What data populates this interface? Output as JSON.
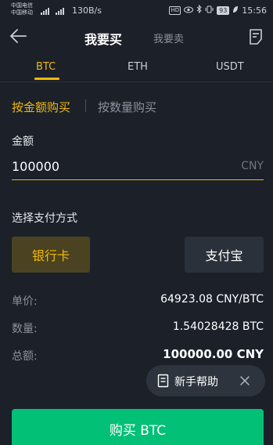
{
  "status_bar": {
    "carrier_1": "中国电信",
    "carrier_2": "中国移动",
    "speed": "130B/s",
    "hd_badge": "HD",
    "battery": "93",
    "time": "15:56"
  },
  "header": {
    "title_active": "我要买",
    "title_inactive": "我要卖"
  },
  "coin_tabs": [
    {
      "label": "BTC",
      "active": true
    },
    {
      "label": "ETH",
      "active": false
    },
    {
      "label": "USDT",
      "active": false
    }
  ],
  "mode": {
    "by_amount": "按金额购买",
    "by_quantity": "按数量购买"
  },
  "amount": {
    "label": "金额",
    "value": "100000",
    "unit": "CNY"
  },
  "payment": {
    "label": "选择支付方式",
    "options": [
      {
        "label": "银行卡",
        "selected": true
      },
      {
        "label": "支付宝",
        "selected": false
      }
    ]
  },
  "summary": {
    "price_label": "单价:",
    "price_value": "64923.08 CNY/BTC",
    "qty_label": "数量:",
    "qty_value": "1.54028428 BTC",
    "total_label": "总额:",
    "total_value": "100000.00 CNY"
  },
  "helper": {
    "label": "新手帮助"
  },
  "buy_button": {
    "label": "购买 BTC"
  },
  "colors": {
    "background": "#1b2029",
    "accent": "#f0b90b",
    "buy": "#02c076"
  }
}
